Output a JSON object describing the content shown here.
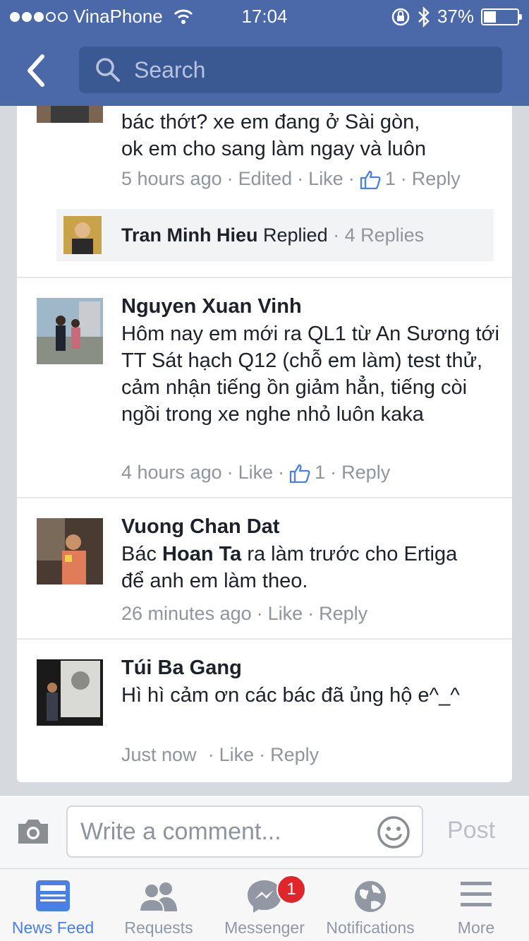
{
  "status_bar": {
    "carrier": "VinaPhone",
    "time": "17:04",
    "battery": "37%",
    "battery_level": 0.37
  },
  "nav": {
    "search_placeholder": "Search"
  },
  "comments": [
    {
      "text_line1": "bác thớt? xe em đang ở Sài gòn,",
      "text_line2": "ok em cho sang làm ngay và luôn",
      "time": "5 hours ago",
      "edited": "Edited",
      "like": "Like",
      "likes_count": "1",
      "reply": "Reply",
      "replies": {
        "name": "Tran Minh Hieu",
        "action": "Replied",
        "count": "4 Replies"
      }
    },
    {
      "name": "Nguyen Xuan Vinh",
      "text": "Hôm nay em mới ra QL1 từ An Sương tới TT Sát hạch Q12 (chỗ em làm) test thử, cảm nhận tiếng ồn giảm hẳn, tiếng còi ngồi trong xe nghe nhỏ luôn kaka",
      "time": "4 hours ago",
      "like": "Like",
      "likes_count": "1",
      "reply": "Reply"
    },
    {
      "name": "Vuong Chan Dat",
      "text_prefix": "Bác ",
      "text_mention": "Hoan Ta",
      "text_suffix": " ra làm trước cho Ertiga để anh em làm theo.",
      "time": "26 minutes ago",
      "like": "Like",
      "reply": "Reply"
    },
    {
      "name": "Túi Ba Gang",
      "text": "Hì hì cảm ơn các bác đã ủng hộ e^_^",
      "time": "Just now",
      "like": "Like",
      "reply": "Reply"
    }
  ],
  "composer": {
    "placeholder": "Write a comment...",
    "post_label": "Post"
  },
  "tabs": [
    {
      "label": "News Feed",
      "icon": "news-feed-icon",
      "active": true
    },
    {
      "label": "Requests",
      "icon": "friends-icon"
    },
    {
      "label": "Messenger",
      "icon": "messenger-icon",
      "badge": "1"
    },
    {
      "label": "Notifications",
      "icon": "globe-icon"
    },
    {
      "label": "More",
      "icon": "menu-icon"
    }
  ],
  "colors": {
    "header": "#4b69a8",
    "search_bg": "#3a5891",
    "active_tab": "#4a7fe5",
    "badge": "#e0262b"
  }
}
